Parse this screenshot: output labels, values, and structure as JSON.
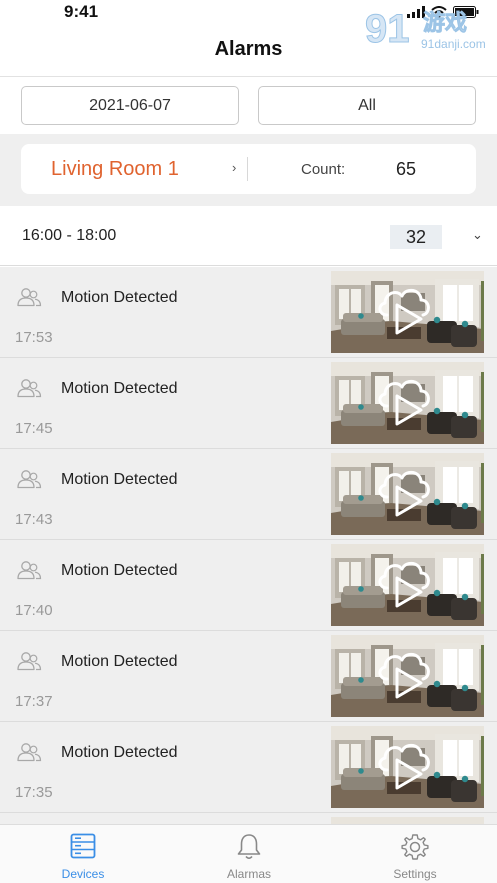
{
  "status_bar": {
    "time": "9:41"
  },
  "watermark": {
    "site": "91danji.com",
    "brand": "游戏"
  },
  "header": {
    "title": "Alarms"
  },
  "filters": {
    "date": "2021-06-07",
    "type": "All"
  },
  "device_card": {
    "name": "Living Room 1",
    "chevron": "›",
    "count_label": "Count:",
    "count_value": "65",
    "name_color": "#e0632f"
  },
  "group": {
    "range": "16:00 - 18:00",
    "count": "32",
    "chevron": "⌄"
  },
  "alarms": [
    {
      "title": "Motion Detected",
      "time": "17:53"
    },
    {
      "title": "Motion Detected",
      "time": "17:45"
    },
    {
      "title": "Motion Detected",
      "time": "17:43"
    },
    {
      "title": "Motion Detected",
      "time": "17:40"
    },
    {
      "title": "Motion Detected",
      "time": "17:37"
    },
    {
      "title": "Motion Detected",
      "time": "17:35"
    }
  ],
  "tabs": [
    {
      "label": "Devices",
      "icon": "server-icon",
      "active": true
    },
    {
      "label": "Alarmas",
      "icon": "bell-icon",
      "active": false
    },
    {
      "label": "Settings",
      "icon": "gear-icon",
      "active": false
    }
  ],
  "colors": {
    "accent": "#3a8ee6",
    "device_name": "#e0632f",
    "background": "#efefef"
  }
}
